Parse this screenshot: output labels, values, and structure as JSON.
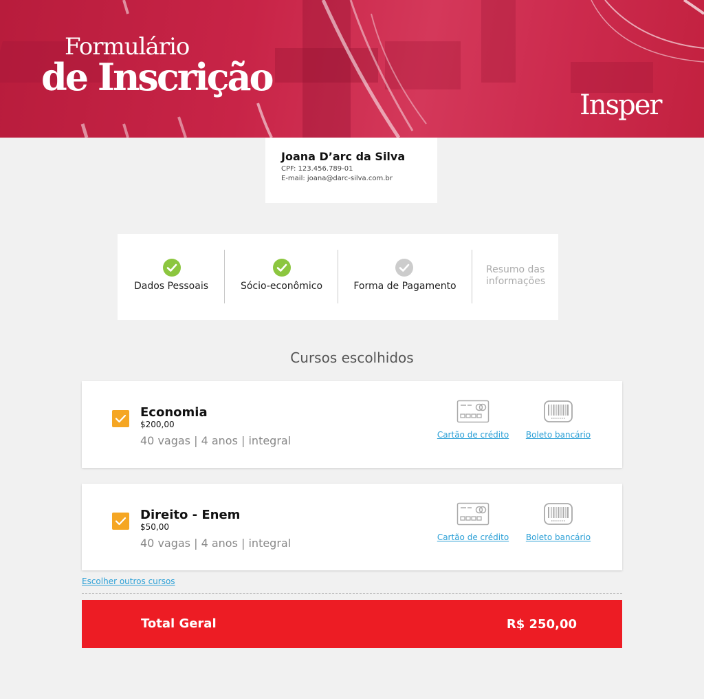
{
  "banner": {
    "title_line1": "Formulário",
    "title_line2": "de Inscrição",
    "brand": "Insper"
  },
  "profile": {
    "name": "Joana D’arc da Silva",
    "cpf": "CPF: 123.456.789-01",
    "email": "E-mail: joana@darc-silva.com.br"
  },
  "steps": [
    {
      "label": "Dados Pessoais",
      "status": "done",
      "color": "#8cc63f"
    },
    {
      "label": "Sócio-econômico",
      "status": "done",
      "color": "#8cc63f"
    },
    {
      "label": "Forma de Pagamento",
      "status": "current",
      "color": "#cccccc"
    },
    {
      "label_line1": "Resumo das",
      "label_line2": "informações",
      "status": "pending"
    }
  ],
  "courses_title": "Cursos escolhidos",
  "courses": [
    {
      "name": "Economia",
      "price": "$200,00",
      "meta": "40 vagas | 4 anos | integral",
      "checked": true,
      "payment_card": "Cartão de crédito",
      "payment_boleto": "Boleto bancário"
    },
    {
      "name": "Direito - Enem",
      "price": "$50,00",
      "meta": "40 vagas | 4 anos | integral",
      "checked": true,
      "payment_card": "Cartão de crédito",
      "payment_boleto": "Boleto bancário"
    }
  ],
  "more_courses_link": "Escolher outros cursos",
  "total": {
    "label": "Total Geral",
    "value": "R$ 250,00"
  },
  "colors": {
    "accent_red": "#ed1c24",
    "banner_red": "#c82447",
    "check_green": "#8cc63f",
    "checkbox_orange": "#f5a623",
    "link_blue": "#2a9fd6"
  }
}
